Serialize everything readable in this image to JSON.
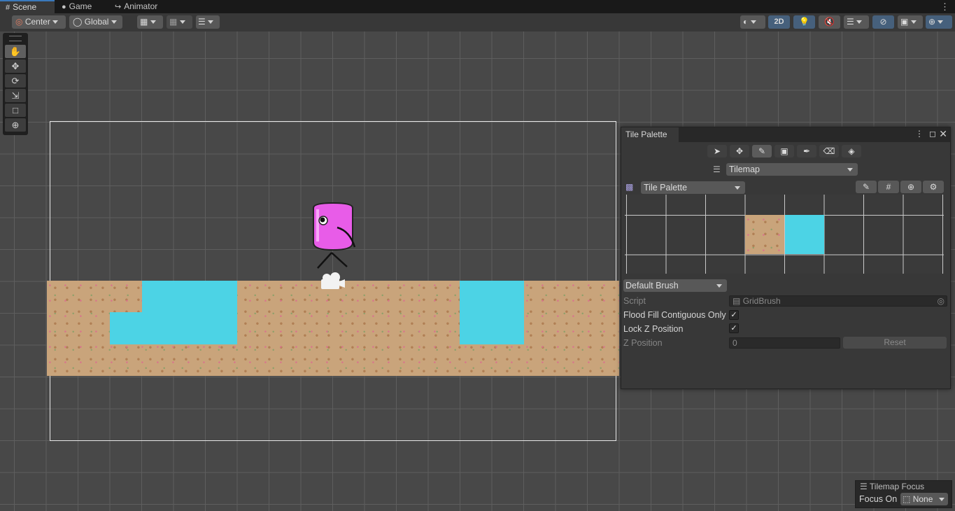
{
  "tabs": [
    {
      "label": "Scene",
      "icon": "grid-icon"
    },
    {
      "label": "Game",
      "icon": "gamepad-icon"
    },
    {
      "label": "Animator",
      "icon": "animator-icon"
    }
  ],
  "toolbar": {
    "pivot": "Center",
    "space": "Global",
    "mode_2d": "2D"
  },
  "tile_palette": {
    "title": "Tile Palette",
    "active_tilemap": "Tilemap",
    "palette": "Tile Palette",
    "brush": "Default Brush",
    "script_label": "Script",
    "script_value": "GridBrush",
    "flood_label": "Flood Fill Contiguous Only",
    "flood_checked": true,
    "lockz_label": "Lock Z Position",
    "lockz_checked": true,
    "zpos_label": "Z Position",
    "zpos_value": "0",
    "reset_label": "Reset"
  },
  "tilemap_focus": {
    "title": "Tilemap Focus",
    "label": "Focus On",
    "value": "None"
  },
  "colors": {
    "water": "#4cd3e5",
    "sand": "#c9a47b",
    "accent": "#46607c"
  }
}
